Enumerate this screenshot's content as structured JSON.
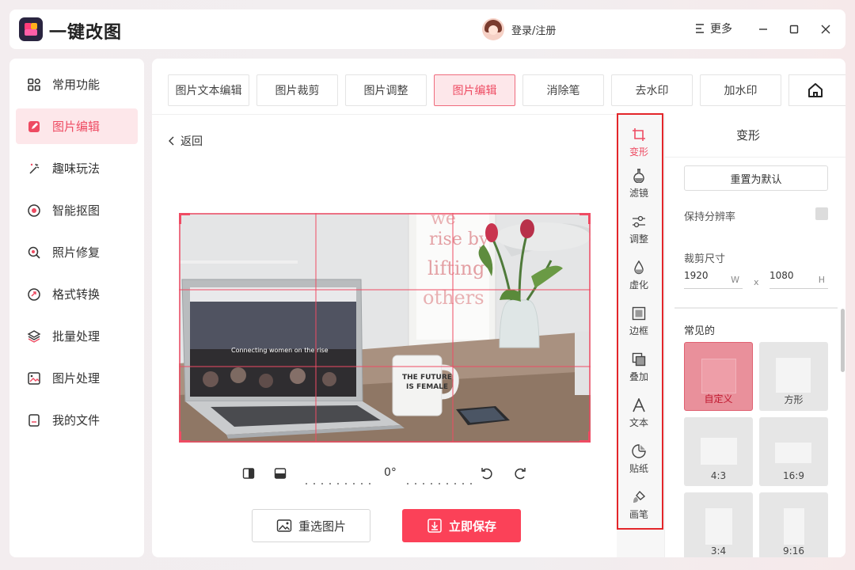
{
  "app": {
    "title": "一键改图",
    "login": "登录/注册",
    "more": "更多"
  },
  "sidebar": {
    "items": [
      {
        "label": "常用功能",
        "icon": "grid-icon"
      },
      {
        "label": "图片编辑",
        "icon": "edit-icon",
        "active": true
      },
      {
        "label": "趣味玩法",
        "icon": "magic-wand-icon"
      },
      {
        "label": "智能抠图",
        "icon": "target-icon"
      },
      {
        "label": "照片修复",
        "icon": "repair-icon"
      },
      {
        "label": "格式转换",
        "icon": "convert-icon"
      },
      {
        "label": "批量处理",
        "icon": "layers-icon"
      },
      {
        "label": "图片处理",
        "icon": "image-icon"
      },
      {
        "label": "我的文件",
        "icon": "file-icon"
      }
    ]
  },
  "tabs": [
    {
      "label": "图片文本编辑"
    },
    {
      "label": "图片裁剪"
    },
    {
      "label": "图片调整"
    },
    {
      "label": "图片编辑",
      "active": true
    },
    {
      "label": "消除笔"
    },
    {
      "label": "去水印"
    },
    {
      "label": "加水印"
    }
  ],
  "editor": {
    "back": "返回",
    "rotation": "0°",
    "reselect": "重选图片",
    "save": "立即保存"
  },
  "photo": {
    "laptop_screen_text": "Connecting women on the rise",
    "mug_text_1": "THE FUTURE",
    "mug_text_2": "IS FEMALE",
    "poster_lines": [
      "we",
      "rise by",
      "lifting",
      "others"
    ]
  },
  "tools": [
    {
      "label": "变形",
      "icon": "crop-icon",
      "active": true
    },
    {
      "label": "滤镜",
      "icon": "filter-flask-icon"
    },
    {
      "label": "调整",
      "icon": "sliders-icon"
    },
    {
      "label": "虚化",
      "icon": "droplet-icon"
    },
    {
      "label": "边框",
      "icon": "frame-icon"
    },
    {
      "label": "叠加",
      "icon": "overlay-icon"
    },
    {
      "label": "文本",
      "icon": "text-icon"
    },
    {
      "label": "贴纸",
      "icon": "sticker-icon"
    },
    {
      "label": "画笔",
      "icon": "brush-icon"
    }
  ],
  "panel": {
    "title": "变形",
    "reset": "重置为默认",
    "keep_resolution": "保持分辨率",
    "crop_size": "裁剪尺寸",
    "width": "1920",
    "width_unit": "W",
    "x": "x",
    "height": "1080",
    "height_unit": "H",
    "common": "常见的",
    "ratios": [
      {
        "label": "自定义",
        "active": true
      },
      {
        "label": "方形"
      },
      {
        "label": "4:3"
      },
      {
        "label": "16:9"
      },
      {
        "label": "3:4"
      },
      {
        "label": "9:16"
      }
    ]
  },
  "colors": {
    "accent": "#ee4b62",
    "save_button": "#fb4158",
    "tool_frame": "#e3262a"
  }
}
